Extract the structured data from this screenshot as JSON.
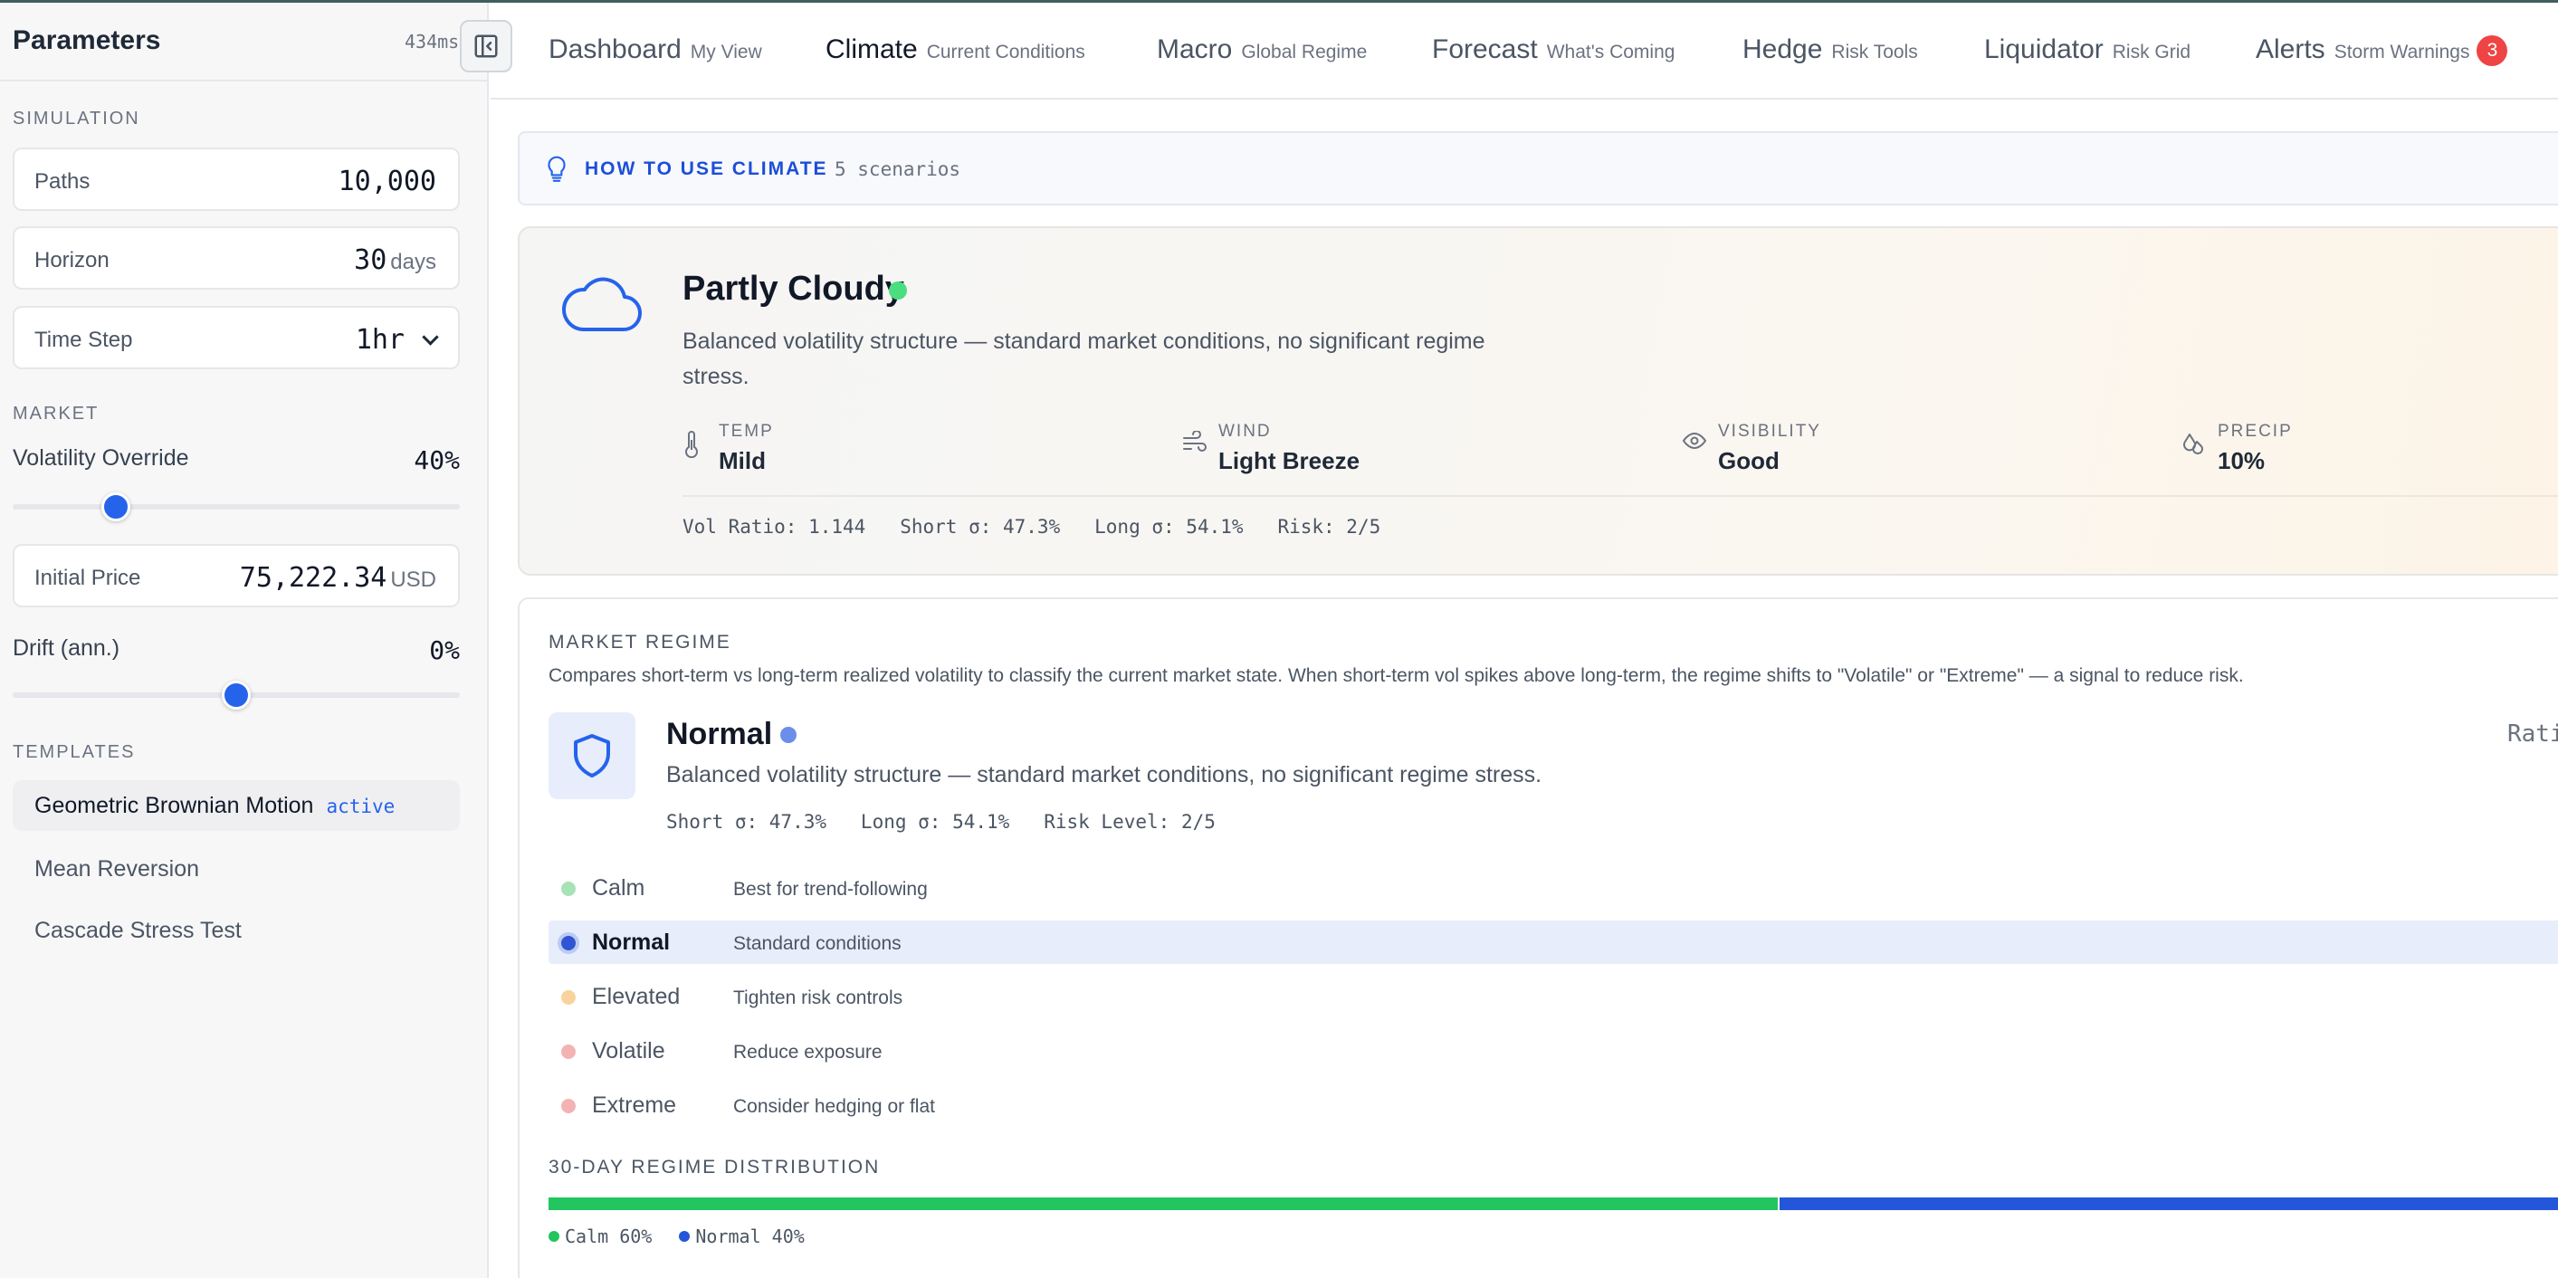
{
  "sidebar": {
    "title": "Parameters",
    "timing": "434ms",
    "simulation_label": "SIMULATION",
    "paths": {
      "label": "Paths",
      "value": "10,000"
    },
    "horizon": {
      "label": "Horizon",
      "value": "30",
      "unit": "days"
    },
    "time_step": {
      "label": "Time Step",
      "value": "1hr"
    },
    "market_label": "MARKET",
    "volatility": {
      "label": "Volatility Override",
      "value": "40%",
      "level": 0.23
    },
    "initial_price": {
      "label": "Initial Price",
      "value": "75,222.34",
      "unit": "USD"
    },
    "drift": {
      "label": "Drift (ann.)",
      "value": "0%",
      "level": 0.5
    },
    "templates_label": "TEMPLATES",
    "templates": [
      {
        "name": "Geometric Brownian Motion",
        "badge": "active"
      },
      {
        "name": "Mean Reversion"
      },
      {
        "name": "Cascade Stress Test"
      }
    ]
  },
  "nav": {
    "tabs": [
      {
        "title": "Dashboard",
        "sub": "My View"
      },
      {
        "title": "Climate",
        "sub": "Current Conditions"
      },
      {
        "title": "Macro",
        "sub": "Global Regime"
      },
      {
        "title": "Forecast",
        "sub": "What's Coming"
      },
      {
        "title": "Hedge",
        "sub": "Risk Tools"
      },
      {
        "title": "Liquidator",
        "sub": "Risk Grid"
      },
      {
        "title": "Alerts",
        "sub": "Storm Warnings",
        "badge": "3"
      }
    ]
  },
  "howto": {
    "title": "HOW TO USE CLIMATE",
    "count": "5 scenarios"
  },
  "weather": {
    "title": "Partly Cloudy",
    "description": "Balanced volatility structure — standard market conditions, no significant regime stress.",
    "metrics": [
      {
        "label": "TEMP",
        "value": "Mild",
        "icon": "thermometer-icon"
      },
      {
        "label": "WIND",
        "value": "Light Breeze",
        "icon": "wind-icon"
      },
      {
        "label": "VISIBILITY",
        "value": "Good",
        "icon": "eye-icon"
      },
      {
        "label": "PRECIP",
        "value": "10%",
        "icon": "droplets-icon"
      }
    ],
    "stats": "Vol Ratio: 1.144   Short σ: 47.3%   Long σ: 54.1%   Risk: 2/5"
  },
  "regime": {
    "label": "MARKET REGIME",
    "description": "Compares short-term vs long-term realized volatility to classify the current market state. When short-term vol spikes above long-term, the regime shifts to \"Volatile\" or \"Extreme\" — a signal to reduce risk.",
    "title": "Normal",
    "subtitle": "Balanced volatility structure — standard market conditions, no significant regime stress.",
    "stats": "Short σ: 47.3%   Long σ: 54.1%   Risk Level: 2/5",
    "ratio_label": "Rati",
    "levels": [
      {
        "name": "Calm",
        "desc": "Best for trend-following",
        "color": "#a7e3b5"
      },
      {
        "name": "Normal",
        "desc": "Standard conditions",
        "color": "#2f55d4",
        "arrow": "←"
      },
      {
        "name": "Elevated",
        "desc": "Tighten risk controls",
        "color": "#f8d49c"
      },
      {
        "name": "Volatile",
        "desc": "Reduce exposure",
        "color": "#f4b3b3"
      },
      {
        "name": "Extreme",
        "desc": "Consider hedging or flat",
        "color": "#f4b3b3"
      }
    ],
    "distribution_label": "30-DAY REGIME DISTRIBUTION",
    "distribution": [
      {
        "name": "Calm",
        "pct": 60,
        "label": "Calm 60%",
        "color": "#22c55e"
      },
      {
        "name": "Normal",
        "pct": 40,
        "label": "Normal 40%",
        "color": "#2456db"
      }
    ]
  }
}
